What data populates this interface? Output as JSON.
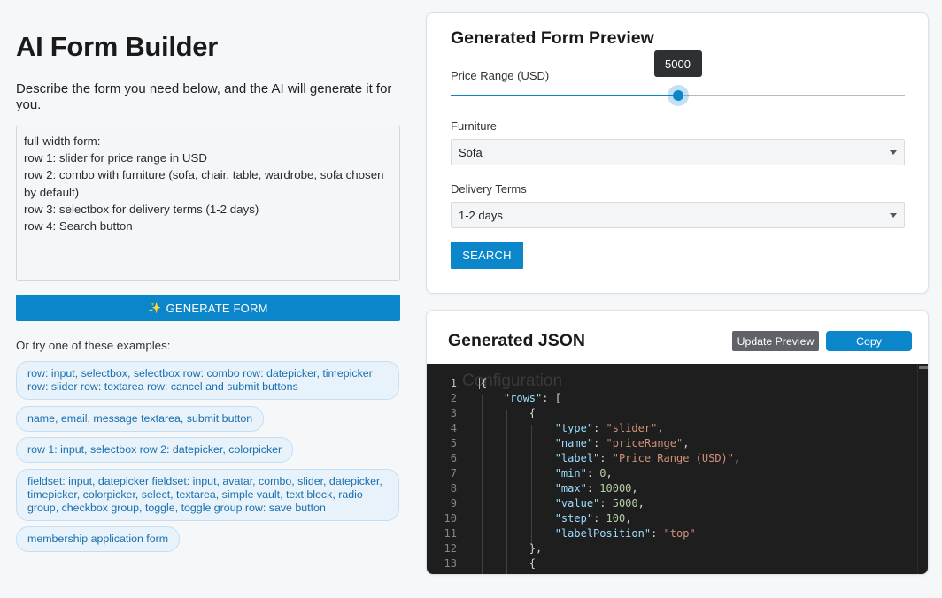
{
  "left": {
    "title": "AI Form Builder",
    "intro": "Describe the form you need below, and the AI will generate it for you.",
    "prompt_value": "full-width form:\nrow 1: slider for price range in USD\nrow 2: combo with furniture (sofa, chair, table, wardrobe, sofa chosen by default)\nrow 3: selectbox for delivery terms (1-2 days)\nrow 4: Search button",
    "generate_icon": "✨",
    "generate_label": "GENERATE FORM",
    "examples_heading": "Or try one of these examples:",
    "examples": [
      "row: input, selectbox, selectbox row: combo row: datepicker, timepicker row: slider row: textarea row: cancel and submit buttons",
      "name, email, message textarea, submit button",
      "row 1: input, selectbox row 2: datepicker, colorpicker",
      "fieldset: input, datepicker fieldset: input, avatar, combo, slider, datepicker, timepicker, colorpicker, select, textarea, simple vault, text block, radio group, checkbox group, toggle, toggle group row: save button",
      "membership application form"
    ]
  },
  "preview": {
    "title": "Generated Form Preview",
    "price_label": "Price Range (USD)",
    "price_value": "5000",
    "price_min": 0,
    "price_max": 10000,
    "furniture_label": "Furniture",
    "furniture_value": "Sofa",
    "delivery_label": "Delivery Terms",
    "delivery_value": "1-2 days",
    "search_label": "SEARCH"
  },
  "json_panel": {
    "title": "Generated JSON",
    "update_label": "Update Preview",
    "copy_label": "Copy",
    "ghost_text": "Configuration",
    "line_numbers": [
      "1",
      "2",
      "3",
      "4",
      "5",
      "6",
      "7",
      "8",
      "9",
      "10",
      "11",
      "12",
      "13"
    ],
    "keys": {
      "rows": "\"rows\"",
      "type": "\"type\"",
      "name": "\"name\"",
      "label": "\"label\"",
      "min": "\"min\"",
      "max": "\"max\"",
      "value": "\"value\"",
      "step": "\"step\"",
      "labelPosition": "\"labelPosition\""
    },
    "values": {
      "type": "\"slider\"",
      "name": "\"priceRange\"",
      "label": "\"Price Range (USD)\"",
      "min": "0",
      "max": "10000",
      "value": "5000",
      "step": "100",
      "labelPosition": "\"top\""
    }
  },
  "colors": {
    "primary": "#0b86cb",
    "secondary_button": "#5f6368",
    "editor_bg": "#1e1e1e"
  }
}
